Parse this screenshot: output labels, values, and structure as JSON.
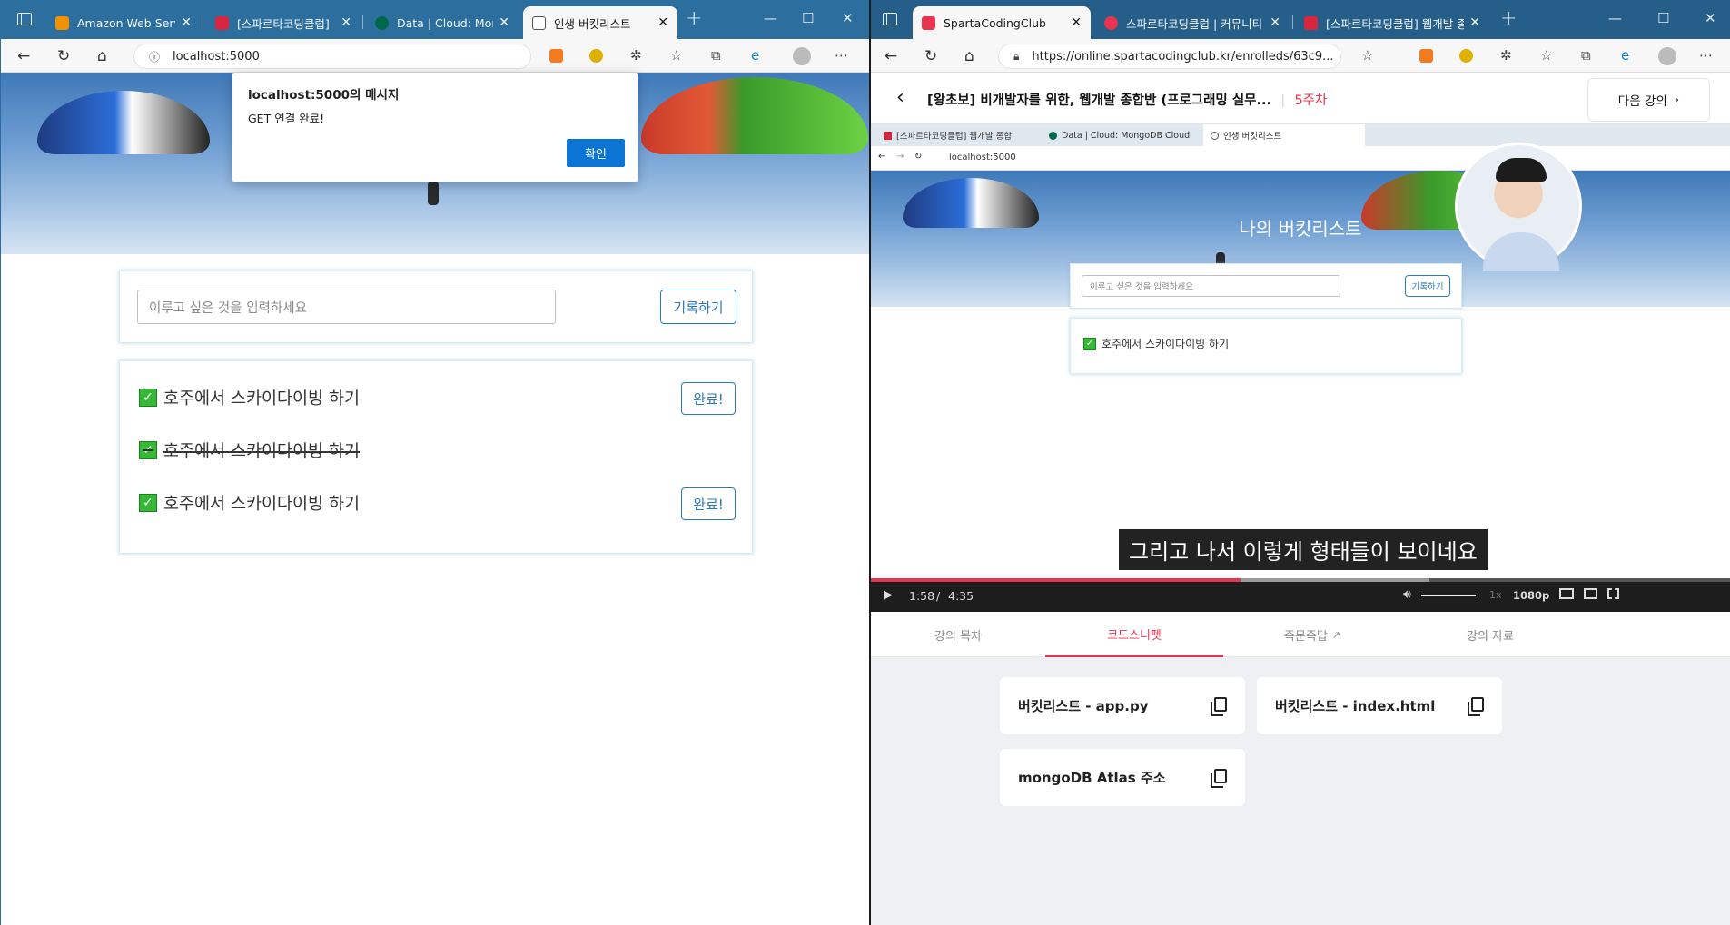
{
  "left": {
    "tabs": [
      {
        "label": "Amazon Web Servic",
        "color": "#f29100"
      },
      {
        "label": "[스파르타코딩클럽]",
        "color": "#d7263d"
      },
      {
        "label": "Data | Cloud: Mongo",
        "color": "#00684a"
      },
      {
        "label": "인생 버킷리스트",
        "color": "#ffffff"
      }
    ],
    "url": "localhost:5000",
    "dialog": {
      "title": "localhost:5000의 메시지",
      "message": "GET 연결 완료!",
      "ok": "확인"
    },
    "input_placeholder": "이루고 싶은 것을 입력하세요",
    "record_button": "기록하기",
    "items": [
      {
        "text": "호주에서 스카이다이빙 하기",
        "done": false,
        "button": "완료!"
      },
      {
        "text": "호주에서 스카이다이빙 하기",
        "done": true,
        "button": ""
      },
      {
        "text": "호주에서 스카이다이빙 하기",
        "done": false,
        "button": "완료!"
      }
    ]
  },
  "right": {
    "tabs": [
      {
        "label": "SpartaCodingClub",
        "color": "#e8344e"
      },
      {
        "label": "스파르타코딩클럽 | 커뮤니티",
        "color": "#e8344e"
      },
      {
        "label": "[스파르타코딩클럽] 웹개발 종합",
        "color": "#d7263d"
      }
    ],
    "url": "https://online.spartacodingclub.kr/enrolleds/63c9...",
    "lecture": {
      "title": "[왕초보] 비개발자를 위한, 웹개발 종합반 (프로그래밍 실무...",
      "week": "5주차",
      "next": "다음 강의"
    },
    "video": {
      "inner_tabs": [
        "[스파르타코딩클럽] 웹개발 종합",
        "Data | Cloud: MongoDB Cloud",
        "인생 버킷리스트"
      ],
      "inner_url": "localhost:5000",
      "hero_title": "나의 버킷리스트",
      "input_placeholder": "이루고 싶은 것을 입력하세요",
      "record_button": "기록하기",
      "item": "호주에서 스카이다이빙 하기",
      "caption": "그리고 나서 이렇게 형태들이 보이네요",
      "time_current": "1:58",
      "time_separator": "/",
      "time_total": "4:35",
      "progress": 0.43,
      "buffered": 0.65,
      "speed": "1x",
      "quality": "1080p"
    },
    "subtabs": [
      "강의 목차",
      "코드스니펫",
      "즉문즉답",
      "강의 자료"
    ],
    "active_subtab": 1,
    "snippets": [
      "버킷리스트 - app.py",
      "버킷리스트 - index.html",
      "mongoDB Atlas 주소"
    ]
  }
}
